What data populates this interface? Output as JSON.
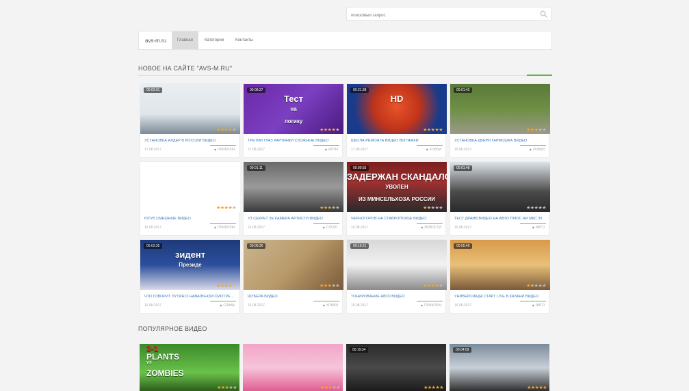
{
  "search": {
    "placeholder": "поисковый запрос",
    "icon": "search-icon"
  },
  "nav": {
    "brand": "avs-m.ru",
    "items": [
      {
        "label": "Главная",
        "active": true
      },
      {
        "label": "Категории",
        "active": false
      },
      {
        "label": "Контакты",
        "active": false
      }
    ]
  },
  "sections": {
    "new_title": "НОВОЕ НА САЙТЕ \"AVS-M.RU\"",
    "popular_title": "ПОПУЛЯРНОЕ ВИДЕО"
  },
  "new_videos": [
    {
      "duration": "00:03:01",
      "title": "УСТАНОВКА АЛДЕР В РОССИИ ВИДЕО",
      "date": "17.08.2017",
      "category": "ПРИКОЛЫ",
      "stars": 4
    },
    {
      "duration": "00:08:37",
      "title": "ТРЕТИЙ ГЛАЗ КАРТИНКИ СЛОЖНЫЕ ВИДЕО",
      "date": "17.08.2017",
      "category": "ИГРЫ",
      "stars": 4,
      "thumb_text": [
        "Тест",
        "на",
        "логику"
      ]
    },
    {
      "duration": "00:21:38",
      "title": "ШКОЛА РЕМОНТА ВИДЕО ВЫТЯЖКИ",
      "date": "17.08.2017",
      "category": "ХОББИ",
      "stars": 5,
      "thumb_text": [
        "HD"
      ]
    },
    {
      "duration": "00:01:43",
      "title": "УСТАНОВКА ДВЕРИ ГАРМОШКА ВИДЕО",
      "date": "16.08.2017",
      "category": "ХОББИ",
      "stars": 3
    },
    {
      "duration": "",
      "title": "ЮТУБ СМЕШНЫЕ ВИДЕО",
      "date": "16.08.2017",
      "category": "ПРИКОЛЫ",
      "stars": 4
    },
    {
      "duration": "00:01:11",
      "title": "УЗ СЕКРЕТ ЗЕ КАМЕРА АРТИСТИ ВИДЕО",
      "date": "16.08.2017",
      "category": "СПОРТ",
      "stars": 3
    },
    {
      "duration": "00:00:55",
      "title": "ЧЕРНОГОРОВ НА СТАВРОПОЛЬЕ ВИДЕО",
      "date": "16.08.2017",
      "category": "НОВОСТИ",
      "stars": 1,
      "thumb_text": [
        "ЗАДЕРЖАН СКАНДАЛОМ",
        "УВОЛЕН",
        "ИЗ МИНСЕЛЬХОЗА РОССИИ"
      ]
    },
    {
      "duration": "00:01:48",
      "title": "ТЕСТ ДРАЙВ ВИДЕО НА АВТО ПЛЮС АЙ МКС 35",
      "date": "16.08.2017",
      "category": "АВТО",
      "stars": 0
    },
    {
      "duration": "00:03:35",
      "title": "ЧТО ГОВОРИТ ПУТИН О НАВАЛЬНОМ СМОТРЕТЬ ВИДЕО",
      "date": "16.08.2017",
      "category": "СЛАВА",
      "stars": 4,
      "thumb_text": [
        "зидент",
        "Президе"
      ]
    },
    {
      "duration": "00:06:26",
      "title": "ШУБЕРА ВИДЕО",
      "date": "16.08.2017",
      "category": "ХОББИ",
      "stars": 3
    },
    {
      "duration": "00:16:21",
      "title": "ТОНИРОВАНИЕ АВТО ВИДЕО",
      "date": "16.08.2017",
      "category": "ПРИКОЛЫ",
      "stars": 4
    },
    {
      "duration": "00:05:49",
      "title": "УНИВЕРСИАДА СТАРТ LIVE В КАЗАНИ ВИДЕО",
      "date": "16.08.2017",
      "category": "АВТО",
      "stars": 1
    }
  ],
  "popular_videos": [
    {
      "duration": "",
      "stars": 3,
      "thumb_text": [
        "3-1",
        "PLANTS",
        "vs",
        "ZOMBIES"
      ]
    },
    {
      "duration": "",
      "stars": 3
    },
    {
      "duration": "00:19:34",
      "stars": 5
    },
    {
      "duration": "00:04:09",
      "stars": 5
    }
  ],
  "colors": {
    "accent": "#6ab04c",
    "link": "#3a7bbd",
    "star": "#f5a623",
    "background": "#f3f3f3"
  }
}
